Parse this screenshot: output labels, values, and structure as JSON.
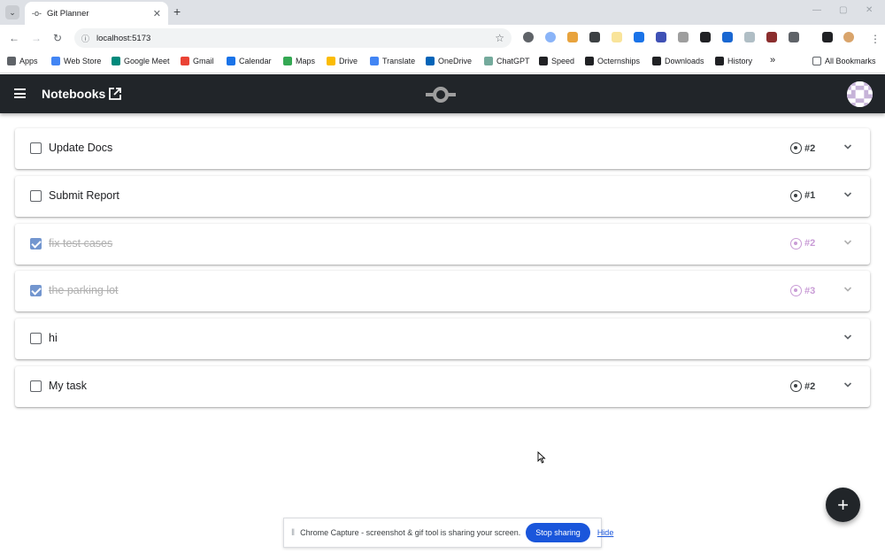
{
  "browser": {
    "tab_title": "Git Planner",
    "url": "localhost:5173",
    "bookmarks": [
      {
        "label": "Apps",
        "icon": "apps-grid-icon",
        "color": "#5f6368"
      },
      {
        "label": "Web Store",
        "icon": "web-store-icon",
        "color": "#4285f4"
      },
      {
        "label": "Google Meet",
        "icon": "meet-icon",
        "color": "#00897b"
      },
      {
        "label": "Gmail",
        "icon": "gmail-icon",
        "color": "#ea4335"
      },
      {
        "label": "Calendar",
        "icon": "calendar-icon",
        "color": "#1a73e8"
      },
      {
        "label": "Maps",
        "icon": "maps-pin-icon",
        "color": "#34a853"
      },
      {
        "label": "Drive",
        "icon": "drive-icon",
        "color": "#fbbc04"
      },
      {
        "label": "Translate",
        "icon": "translate-icon",
        "color": "#4285f4"
      },
      {
        "label": "OneDrive",
        "icon": "onedrive-icon",
        "color": "#0364b8"
      },
      {
        "label": "ChatGPT",
        "icon": "chatgpt-icon",
        "color": "#74aa9c"
      },
      {
        "label": "Speed",
        "icon": "speed-icon",
        "color": "#202124"
      },
      {
        "label": "Octernships",
        "icon": "github-icon",
        "color": "#202124"
      },
      {
        "label": "Downloads",
        "icon": "download-icon",
        "color": "#202124"
      },
      {
        "label": "History",
        "icon": "history-icon",
        "color": "#202124"
      }
    ],
    "all_bookmarks": "All Bookmarks"
  },
  "app": {
    "title": "Notebooks"
  },
  "tasks": [
    {
      "title": "Update Docs",
      "checked": false,
      "issue": "#2"
    },
    {
      "title": "Submit Report",
      "checked": false,
      "issue": "#1"
    },
    {
      "title": "fix test cases",
      "checked": true,
      "issue": "#2"
    },
    {
      "title": "the parking lot",
      "checked": true,
      "issue": "#3"
    },
    {
      "title": "hi",
      "checked": false,
      "issue": ""
    },
    {
      "title": "My task",
      "checked": false,
      "issue": "#2"
    }
  ],
  "fab": {
    "label": "+"
  },
  "sharebar": {
    "message": "Chrome Capture - screenshot & gif tool is sharing your screen.",
    "stop_label": "Stop sharing",
    "hide_label": "Hide"
  },
  "colors": {
    "appbar": "#212529",
    "checked": "#7396cf",
    "done_issue": "#c99cd6",
    "share_button": "#1a56db"
  }
}
